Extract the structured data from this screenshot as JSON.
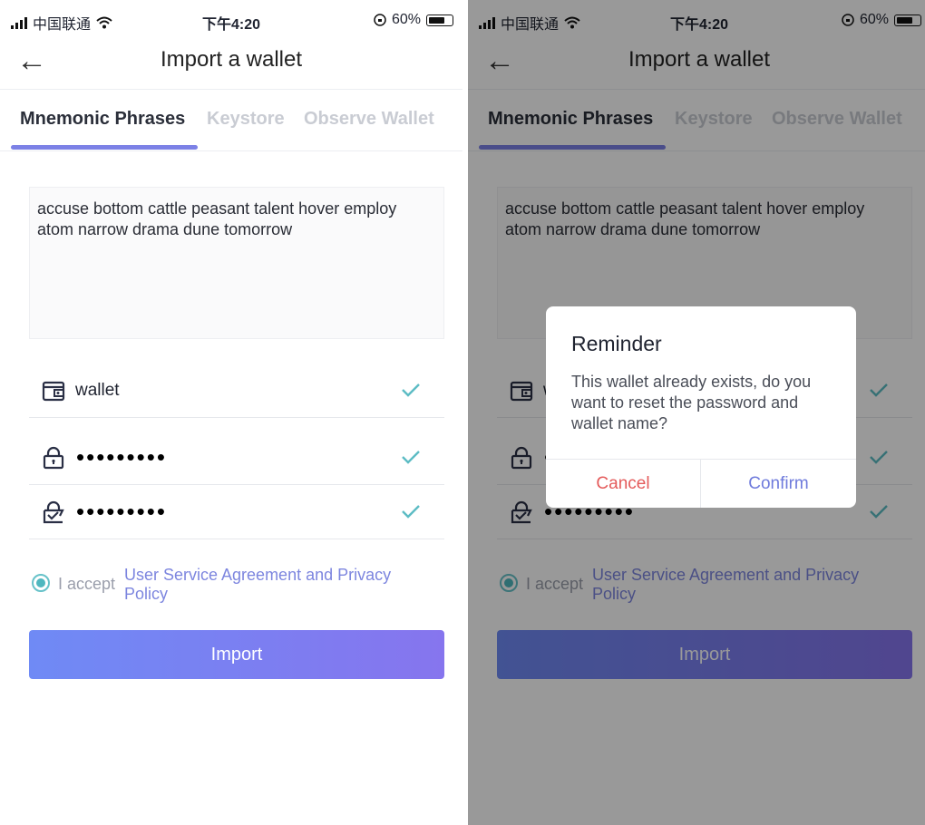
{
  "status_bar": {
    "carrier": "中国联通",
    "time": "下午4:20",
    "battery": "60%"
  },
  "header": {
    "title": "Import a wallet"
  },
  "tabs": [
    {
      "label": "Mnemonic Phrases",
      "active": true
    },
    {
      "label": "Keystore",
      "active": false
    },
    {
      "label": "Observe Wallet",
      "active": false
    }
  ],
  "form": {
    "mnemonic": "accuse bottom cattle peasant talent hover employ atom narrow drama dune tomorrow",
    "wallet_name": "wallet",
    "password_mask": "•••••••••",
    "confirm_password_mask": "•••••••••"
  },
  "agreement": {
    "prefix": "I accept",
    "link": "User Service Agreement and Privacy Policy",
    "checked": true
  },
  "import_button": "Import",
  "dialog": {
    "title": "Reminder",
    "message": "This wallet already exists, do you want to reset the password and wallet name?",
    "cancel": "Cancel",
    "confirm": "Confirm"
  },
  "colors": {
    "accent": "#7c81e6",
    "check": "#5cbcc4",
    "cancel": "#e45b5b",
    "confirm": "#6f7bdc"
  },
  "icons": [
    "back-arrow-icon",
    "wallet-icon",
    "lock-icon",
    "lock-check-icon",
    "checkmark-icon",
    "wifi-icon",
    "signal-icon",
    "battery-icon"
  ]
}
